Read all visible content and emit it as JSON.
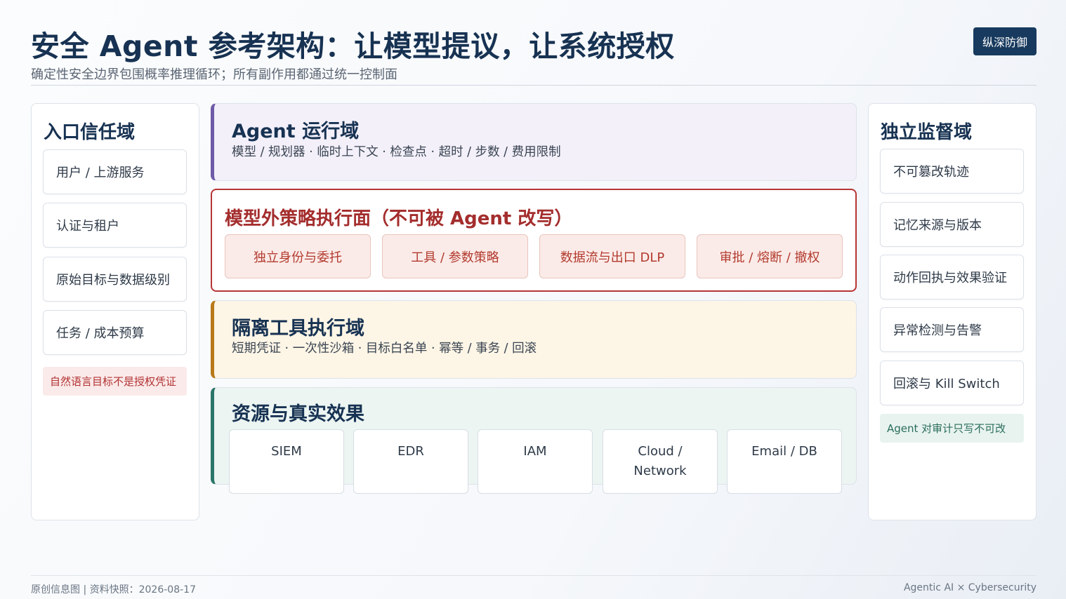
{
  "header": {
    "title": "安全 Agent 参考架构：让模型提议，让系统授权",
    "subtitle": "确定性安全边界包围概率推理循环；所有副作用都通过统一控制面",
    "badge": "纵深防御"
  },
  "left_panel": {
    "title": "入口信任域",
    "items": [
      "用户 / 上游服务",
      "认证与租户",
      "原始目标与数据级别",
      "任务 / 成本预算"
    ],
    "note": "自然语言目标不是授权凭证"
  },
  "runtime_panel": {
    "title": "Agent 运行域",
    "description": "模型 / 规划器 · 临时上下文 · 检查点 · 超时 / 步数 / 费用限制"
  },
  "policy_panel": {
    "title": "模型外策略执行面（不可被 Agent 改写）",
    "items": [
      "独立身份与委托",
      "工具 / 参数策略",
      "数据流与出口 DLP",
      "审批 / 熔断 / 撤权"
    ]
  },
  "tools_panel": {
    "title": "隔离工具执行域",
    "description": "短期凭证 · 一次性沙箱 · 目标白名单 · 幂等 / 事务 / 回滚"
  },
  "resources_panel": {
    "title": "资源与真实效果",
    "items": [
      {
        "line1": "SIEM",
        "line2": ""
      },
      {
        "line1": "EDR",
        "line2": ""
      },
      {
        "line1": "IAM",
        "line2": ""
      },
      {
        "line1": "Cloud /",
        "line2": "Network"
      },
      {
        "line1": "Email / DB",
        "line2": ""
      }
    ]
  },
  "right_panel": {
    "title": "独立监督域",
    "items": [
      "不可篡改轨迹",
      "记忆来源与版本",
      "动作回执与效果验证",
      "异常检测与告警",
      "回滚与 Kill Switch"
    ],
    "note": "Agent 对审计只写不可改"
  },
  "footer": {
    "left": "原创信息图 | 资料快照：2026-08-17",
    "right": "Agentic AI × Cybersecurity"
  },
  "colors": {
    "title": "#173252",
    "runtime_accent": "#6f5aa8",
    "policy_accent": "#b73535",
    "tools_accent": "#b97918",
    "resources_accent": "#2a7668"
  }
}
